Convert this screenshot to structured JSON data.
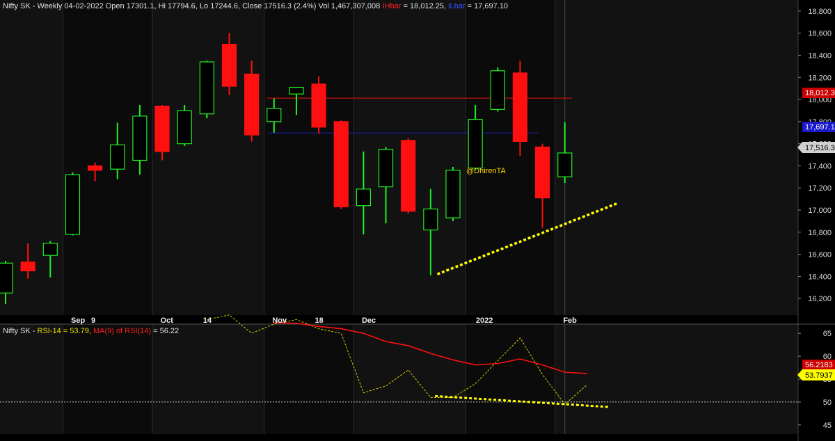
{
  "colors": {
    "background": "#000000",
    "panel": "#121212",
    "panel_dark": "#0b0b0b",
    "grid": "#2c2c2c",
    "axis_text": "#dcdcdc",
    "up_body": "#000000",
    "up_border": "#22ee22",
    "down_body": "#ff1010",
    "hline_red": "#c01010",
    "hline_blue": "#1a1aa0",
    "trendline": "#ffff00",
    "rsi_line": "#d8d000",
    "rsi_ma_line": "#ff1010",
    "watermark": "#ffd200"
  },
  "header": {
    "prefix": "Nifty SK - Weekly 04-02-2022 Open 17301.1, Hi 17794.6, Lo 17244.6, Close 17516.3 (2.4%) Vol 1,467,307,008",
    "hbar_label": "iHbar",
    "hbar_value": " = 18,012.25, ",
    "lbar_label": "iLbar",
    "lbar_value": " = 17,697.10"
  },
  "rsi_header": {
    "prefix": "Nifty SK - ",
    "rsi_text": "RSI-14 = 53.79, ",
    "ma_text": "MA(9) of RSI(14)",
    "ma_value": " = 56.22"
  },
  "watermark": "@DhirenTA",
  "price_labels": {
    "hbar": "18,012.3",
    "lbar": "17,697.1",
    "close": "17,516.3"
  },
  "rsi_labels": {
    "ma": "56.2183",
    "rsi": "53.7937"
  },
  "chart_data": [
    {
      "type": "candlestick",
      "title": "Nifty SK - Weekly",
      "ylim": [
        16050,
        18900
      ],
      "y_ticks": [
        16200,
        16400,
        16600,
        16800,
        17000,
        17200,
        17400,
        17600,
        17800,
        18000,
        18200,
        18400,
        18600,
        18800
      ],
      "y_tick_labels": [
        "16,200",
        "16,400",
        "16,600",
        "16,800",
        "17,000",
        "17,200",
        "17,400",
        "17,600",
        "17,800",
        "18,000",
        "18,200",
        "18,400",
        "18,600",
        "18,800"
      ],
      "x_labels": [
        {
          "bar": 3.3,
          "label": "Sep"
        },
        {
          "bar": 4.2,
          "label": "9"
        },
        {
          "bar": 7.3,
          "label": "Oct"
        },
        {
          "bar": 9.2,
          "label": "14"
        },
        {
          "bar": 12.3,
          "label": "Nov"
        },
        {
          "bar": 14.2,
          "label": "18"
        },
        {
          "bar": 16.3,
          "label": "Dec"
        },
        {
          "bar": 21.4,
          "label": "2022"
        },
        {
          "bar": 25.3,
          "label": "Feb"
        }
      ],
      "vertical_gridlines_at_bar": [
        3,
        7,
        12,
        16,
        21,
        25
      ],
      "candles": [
        {
          "o": 16250,
          "h": 16540,
          "l": 16150,
          "c": 16520
        },
        {
          "o": 16530,
          "h": 16700,
          "l": 16380,
          "c": 16450
        },
        {
          "o": 16590,
          "h": 16720,
          "l": 16390,
          "c": 16700
        },
        {
          "o": 16780,
          "h": 17340,
          "l": 16770,
          "c": 17320
        },
        {
          "o": 17400,
          "h": 17430,
          "l": 17260,
          "c": 17360
        },
        {
          "o": 17370,
          "h": 17790,
          "l": 17280,
          "c": 17590
        },
        {
          "o": 17450,
          "h": 17950,
          "l": 17320,
          "c": 17850
        },
        {
          "o": 17940,
          "h": 17950,
          "l": 17450,
          "c": 17530
        },
        {
          "o": 17600,
          "h": 17950,
          "l": 17580,
          "c": 17900
        },
        {
          "o": 17870,
          "h": 18350,
          "l": 17830,
          "c": 18340
        },
        {
          "o": 18500,
          "h": 18600,
          "l": 18040,
          "c": 18120
        },
        {
          "o": 18230,
          "h": 18350,
          "l": 17620,
          "c": 17680
        },
        {
          "o": 17800,
          "h": 18010,
          "l": 17700,
          "c": 17920
        },
        {
          "o": 18050,
          "h": 18110,
          "l": 17860,
          "c": 18110
        },
        {
          "o": 18140,
          "h": 18210,
          "l": 17690,
          "c": 17750
        },
        {
          "o": 17800,
          "h": 17810,
          "l": 17010,
          "c": 17030
        },
        {
          "o": 17040,
          "h": 17530,
          "l": 16780,
          "c": 17190
        },
        {
          "o": 17210,
          "h": 17570,
          "l": 16880,
          "c": 17550
        },
        {
          "o": 17630,
          "h": 17650,
          "l": 16970,
          "c": 16990
        },
        {
          "o": 16820,
          "h": 17190,
          "l": 16410,
          "c": 17010
        },
        {
          "o": 16930,
          "h": 17390,
          "l": 16900,
          "c": 17360
        },
        {
          "o": 17380,
          "h": 17950,
          "l": 17360,
          "c": 17820
        },
        {
          "o": 17910,
          "h": 18290,
          "l": 17890,
          "c": 18260
        },
        {
          "o": 18240,
          "h": 18350,
          "l": 17490,
          "c": 17620
        },
        {
          "o": 17570,
          "h": 17600,
          "l": 16840,
          "c": 17110
        },
        {
          "o": 17301.1,
          "h": 17794.6,
          "l": 17244.6,
          "c": 17516.3
        }
      ],
      "horizontal_lines": [
        {
          "name": "iHbar",
          "value": 18012.25,
          "from_bar": 12,
          "to_bar": 25
        },
        {
          "name": "iLbar",
          "value": 17697.1,
          "from_bar": 12,
          "to_bar": 23.5
        }
      ],
      "trendline": {
        "from": {
          "bar": 19.3,
          "value": 16420
        },
        "to": {
          "bar": 27.4,
          "value": 17065
        }
      }
    },
    {
      "type": "line",
      "title": "Nifty SK - RSI-14 = 53.79, MA(9) of RSI(14) = 56.22",
      "ylim": [
        43,
        67
      ],
      "y_ticks": [
        45,
        50,
        55,
        60,
        65
      ],
      "y_tick_labels": [
        "45",
        "50",
        "55",
        "60",
        "65"
      ],
      "reference_line": 50,
      "series": [
        {
          "name": "RSI-14",
          "start_bar": 9,
          "values": [
            68,
            69,
            65,
            67,
            68,
            66,
            65,
            52,
            53.5,
            57,
            51,
            51,
            54,
            59,
            64,
            56,
            49.5,
            53.8
          ]
        },
        {
          "name": "MA(9) of RSI(14)",
          "start_bar": 12,
          "values": [
            67.3,
            67.2,
            66.5,
            66,
            65,
            63.2,
            62.3,
            60.6,
            59.2,
            58.1,
            58.4,
            59.4,
            58.1,
            56.5,
            56.2
          ]
        }
      ],
      "trendline": {
        "from": {
          "bar": 19.2,
          "value": 51.3
        },
        "to": {
          "bar": 27,
          "value": 48.9
        }
      }
    }
  ]
}
